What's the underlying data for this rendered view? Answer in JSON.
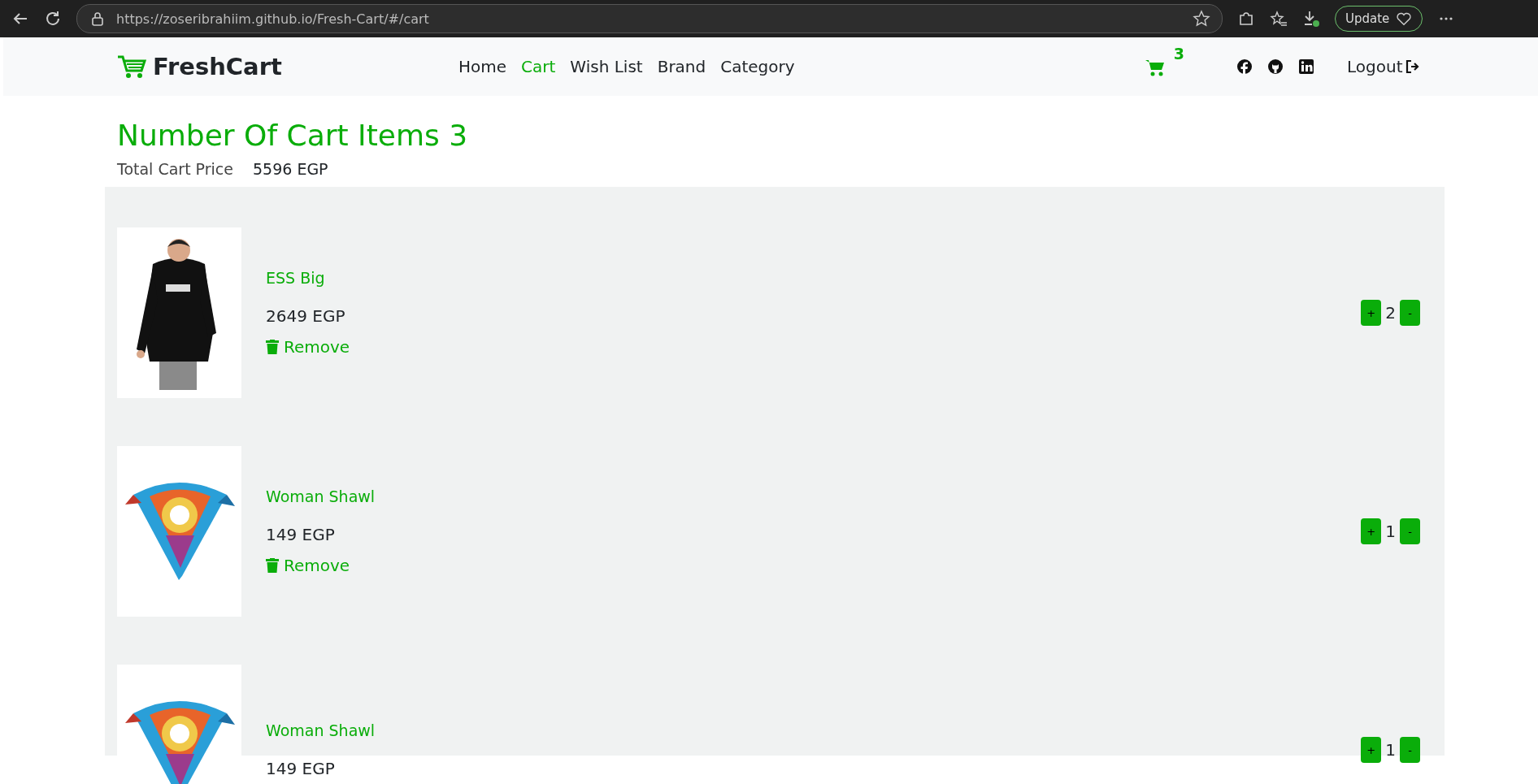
{
  "browser": {
    "url": "https://zoseribrahiim.github.io/Fresh-Cart/#/cart",
    "update_label": "Update"
  },
  "navbar": {
    "brand": "FreshCart",
    "links": [
      {
        "label": "Home",
        "selected": false
      },
      {
        "label": "Cart",
        "selected": true
      },
      {
        "label": "Wish List",
        "selected": false
      },
      {
        "label": "Brand",
        "selected": false
      },
      {
        "label": "Category",
        "selected": false
      }
    ],
    "cart_count": "3",
    "logout": "Logout"
  },
  "cart": {
    "heading": "Number Of Cart Items 3",
    "total_label": "Total Cart Price",
    "total_value": "5596 EGP",
    "items": [
      {
        "name": "ESS Big",
        "price": "2649 EGP",
        "remove": "Remove",
        "quantity": "2",
        "plus": "+",
        "minus": "-"
      },
      {
        "name": "Woman Shawl",
        "price": "149 EGP",
        "remove": "Remove",
        "quantity": "1",
        "plus": "+",
        "minus": "-"
      },
      {
        "name": "Woman Shawl",
        "price": "149 EGP",
        "quantity": "1",
        "plus": "+",
        "minus": "-"
      }
    ]
  }
}
